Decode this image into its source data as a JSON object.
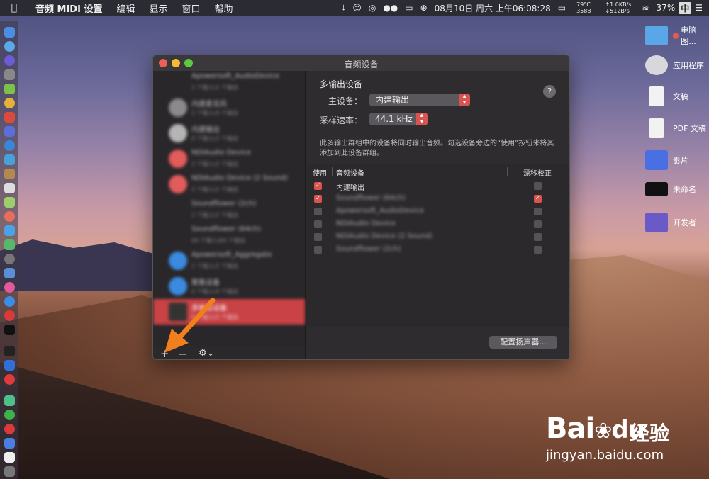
{
  "menubar": {
    "app_name": "音频 MIDI 设置",
    "items": [
      "编辑",
      "显示",
      "窗口",
      "帮助"
    ],
    "status": {
      "temp": "79°C",
      "cpu": "3588",
      "net_up": "↑1.0KB/s",
      "net_down": "↓512B/s",
      "datetime": "08月10日 周六 上午06:08:28",
      "battery": "37%",
      "ime": "中"
    }
  },
  "window": {
    "title": "音频设备",
    "sidebar": {
      "devices": [
        {
          "name": "Apowersoft_AudioDevice",
          "sub": "2 个输入/2 个输出"
        },
        {
          "name": "内建麦克风",
          "sub": "2 个输入/0 个输出"
        },
        {
          "name": "内建输出",
          "sub": "0 个输入/2 个输出"
        },
        {
          "name": "NDIAudio Device",
          "sub": "2 个输入/2 个输出"
        },
        {
          "name": "NDIAudio Device (2 Sound)",
          "sub": "2 个输入/2 个输出"
        },
        {
          "name": "Soundflower (2ch)",
          "sub": "2 个输入/2 个输出"
        },
        {
          "name": "Soundflower (64ch)",
          "sub": "64 个输入/64 个输出"
        },
        {
          "name": "Apowersoft_Aggregate",
          "sub": "2 个输入/2 个输出"
        },
        {
          "name": "聚集设备",
          "sub": "0 个输入/0 个输出"
        },
        {
          "name": "多输出设备",
          "sub": "0 个输入/2 个输出"
        }
      ],
      "add_symbol": "+",
      "remove_symbol": "—",
      "gear_symbol": "⚙⌄"
    },
    "detail": {
      "heading": "多输出设备",
      "master_label": "主设备：",
      "master_value": "内建输出",
      "rate_label": "采样速率：",
      "rate_value": "44.1 kHz",
      "description": "此多输出群组中的设备将同时输出音频。勾选设备旁边的“使用”按钮来将其添加到此设备群组。",
      "help": "?",
      "table": {
        "col_use": "使用",
        "col_device": "音频设备",
        "col_drift": "漂移校正",
        "rows": [
          {
            "name": "内建输出",
            "use": true,
            "drift": false
          },
          {
            "name": "Soundflower (64ch)",
            "use": true,
            "drift": true
          },
          {
            "name": "Apowersoft_AudioDevice",
            "use": false,
            "drift": false
          },
          {
            "name": "NDIAudio Device",
            "use": false,
            "drift": false
          },
          {
            "name": "NDIAudio Device (2 Sound)",
            "use": false,
            "drift": false
          },
          {
            "name": "Soundflower (2ch)",
            "use": false,
            "drift": false
          }
        ]
      },
      "configure_button": "配置扬声器..."
    }
  },
  "desktop": {
    "items": [
      "电脑图...",
      "应用程序",
      "文稿",
      "PDF 文稿",
      "影片",
      "未命名",
      "开发者"
    ]
  },
  "watermark": {
    "brand": "Bai",
    "brand_cn": "经验",
    "url": "jingyan.baidu.com"
  },
  "colors": {
    "accent": "#d9534f",
    "selection": "#c94245",
    "arrow": "#f07f1d"
  }
}
